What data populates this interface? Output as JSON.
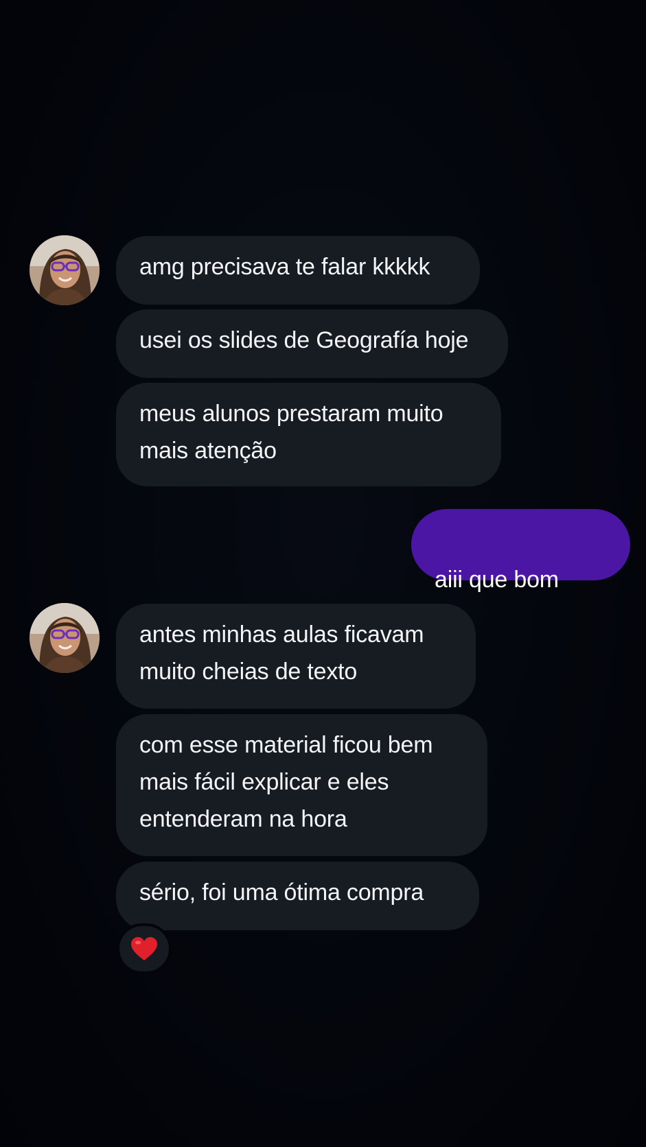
{
  "conversation": {
    "group1": {
      "messages": [
        {
          "text": "amg precisava te falar kkkkk"
        },
        {
          "text": "usei os slides de Geografía hoje"
        },
        {
          "text": "meus alunos prestaram muito\nmais atenção"
        }
      ]
    },
    "sent": {
      "text": "aiii que bom",
      "emoji": "😭"
    },
    "group2": {
      "messages": [
        {
          "text": "antes minhas aulas ficavam\nmuito cheias de texto"
        },
        {
          "text": "com esse material ficou bem\nmais fácil explicar e eles\nentenderam na hora"
        },
        {
          "text": "sério, foi uma ótima compra"
        }
      ]
    },
    "reaction": {
      "icon": "red-heart-icon",
      "color": "#e0202a"
    }
  },
  "colors": {
    "background": "#03050c",
    "received_bubble": "#171b22",
    "sent_bubble": "#4a16a3"
  }
}
